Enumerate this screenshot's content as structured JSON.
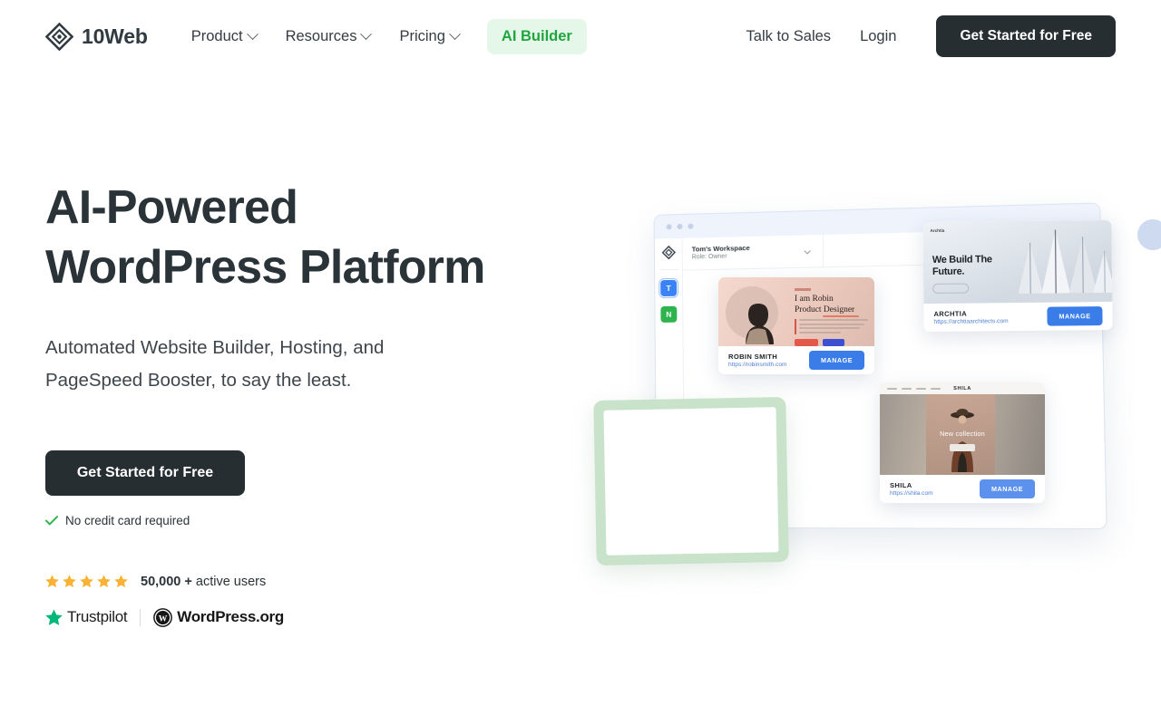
{
  "header": {
    "brand_name": "10Web",
    "brand_icon": "diamond-logo-icon",
    "nav": [
      {
        "label": "Product",
        "has_caret": true
      },
      {
        "label": "Resources",
        "has_caret": true
      },
      {
        "label": "Pricing",
        "has_caret": true
      }
    ],
    "accent_nav_label": "AI Builder",
    "talk_to_sales_label": "Talk to Sales",
    "login_label": "Login",
    "cta_label": "Get Started for Free"
  },
  "hero": {
    "title_line1": "AI-Powered",
    "title_line2": "WordPress Platform",
    "subtitle_line1": "Automated Website Builder, Hosting, and",
    "subtitle_line2": "PageSpeed Booster, to say the least.",
    "cta_label": "Get Started for Free",
    "no_card_text": "No credit card required",
    "check_icon": "check-icon",
    "rating": {
      "stars": 5,
      "count": "50,000",
      "plus": "+",
      "suffix": "active users"
    },
    "badges": [
      {
        "name": "Trustpilot",
        "icon": "trustpilot-star-icon"
      },
      {
        "name": "WordPress.org",
        "icon": "wordpress-logo-icon"
      }
    ]
  },
  "illustration": {
    "dashboard": {
      "workspace_title": "Tom's Workspace",
      "workspace_role": "Role: Owner",
      "rail_avatars": [
        {
          "letter": "T",
          "color": "#3B82F6"
        },
        {
          "letter": "N",
          "color": "#2FB34E"
        }
      ]
    },
    "site_cards": [
      {
        "name": "ROBIN SMITH",
        "url": "https://robinsmith.com",
        "manage_label": "MANAGE",
        "headline_line1": "I am Robin",
        "headline_line2": "Product Designer"
      },
      {
        "name": "ARCHTIA",
        "url": "https://archtiaarchitects.com",
        "manage_label": "MANAGE",
        "headline_line1": "We Build The",
        "headline_line2": "Future.",
        "logo_text": "Archtia"
      },
      {
        "name": "SHILA",
        "url": "https://shila.com",
        "manage_label": "MANAGE",
        "brand": "SHILA",
        "overlay_text": "New collection"
      }
    ]
  },
  "colors": {
    "dark": "#272E32",
    "accent_green": "#21A63F",
    "accent_green_bg": "#E4F7E8",
    "star_amber": "#F9B233",
    "trustpilot_green": "#00B67A",
    "manage_blue": "#3B7DE8",
    "card_green": "#C9E3CB"
  }
}
